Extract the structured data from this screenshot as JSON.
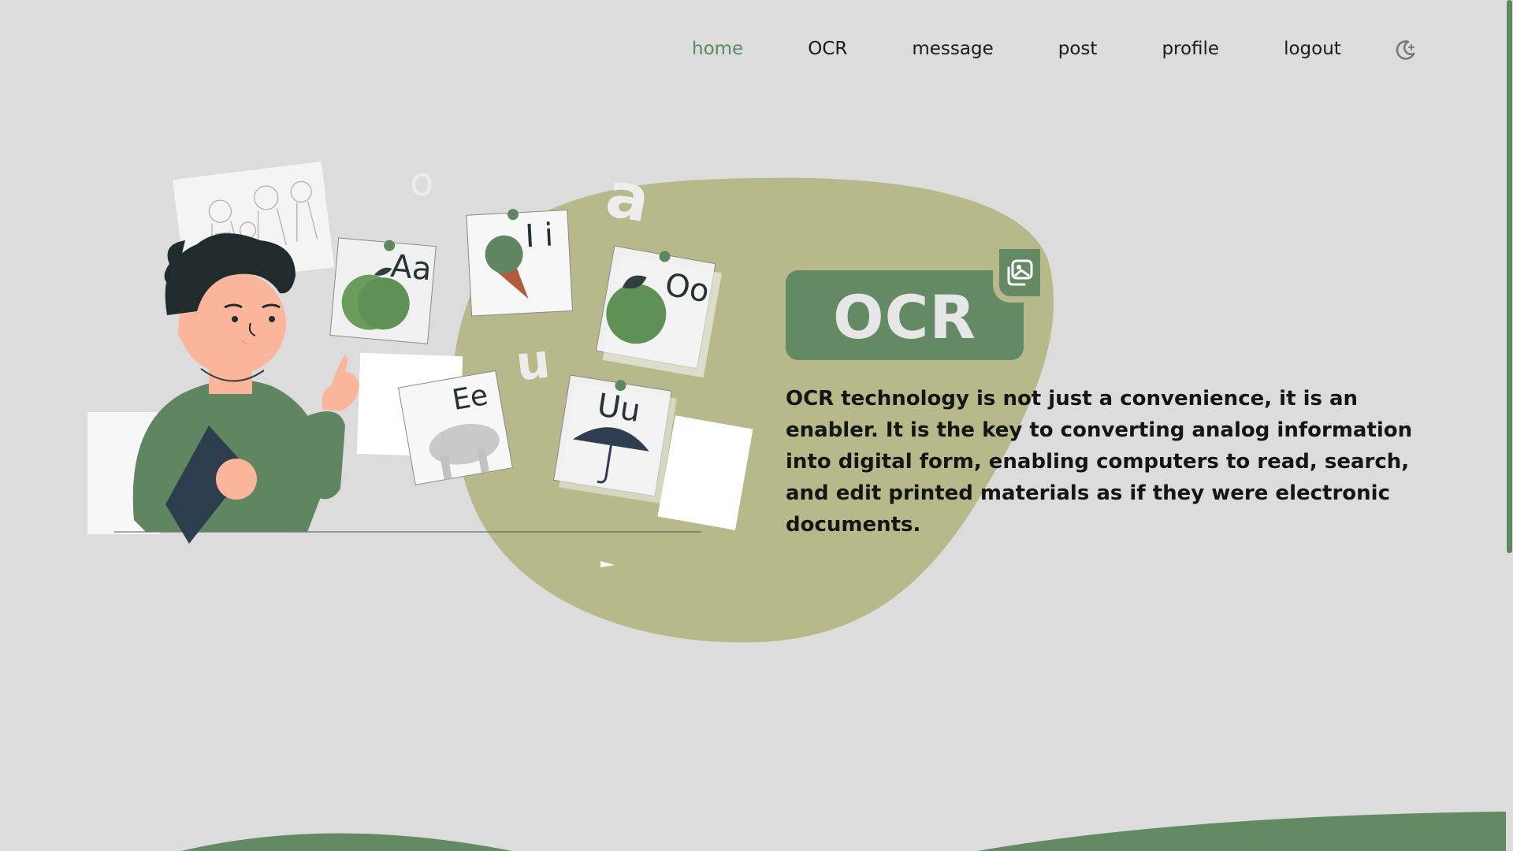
{
  "nav": {
    "items": [
      {
        "label": "home",
        "active": true
      },
      {
        "label": "OCR",
        "active": false
      },
      {
        "label": "message",
        "active": false
      },
      {
        "label": "post",
        "active": false
      },
      {
        "label": "profile",
        "active": false
      },
      {
        "label": "logout",
        "active": false
      }
    ],
    "theme_icon": "moon-icon"
  },
  "hero": {
    "badge_title": "OCR",
    "badge_icon": "gallery-icon",
    "description": "OCR technology is not just a convenience, it is an enabler. It is the key to converting analog information into digital form, enabling computers to read, search, and edit printed materials as if they were electronic documents."
  },
  "illustration": {
    "cards": [
      {
        "text": "Aa",
        "picture": "apple"
      },
      {
        "text": "I i",
        "picture": "ice-cream"
      },
      {
        "text": "Oo",
        "picture": "orange"
      },
      {
        "text": "Ee",
        "picture": "elephant"
      },
      {
        "text": "Uu",
        "picture": "umbrella"
      }
    ],
    "floating_letters": [
      "a",
      "u",
      "o"
    ]
  },
  "colors": {
    "background": "#dcdcdc",
    "accent": "#638a63",
    "blob": "#b7b98a",
    "text": "#151515"
  }
}
